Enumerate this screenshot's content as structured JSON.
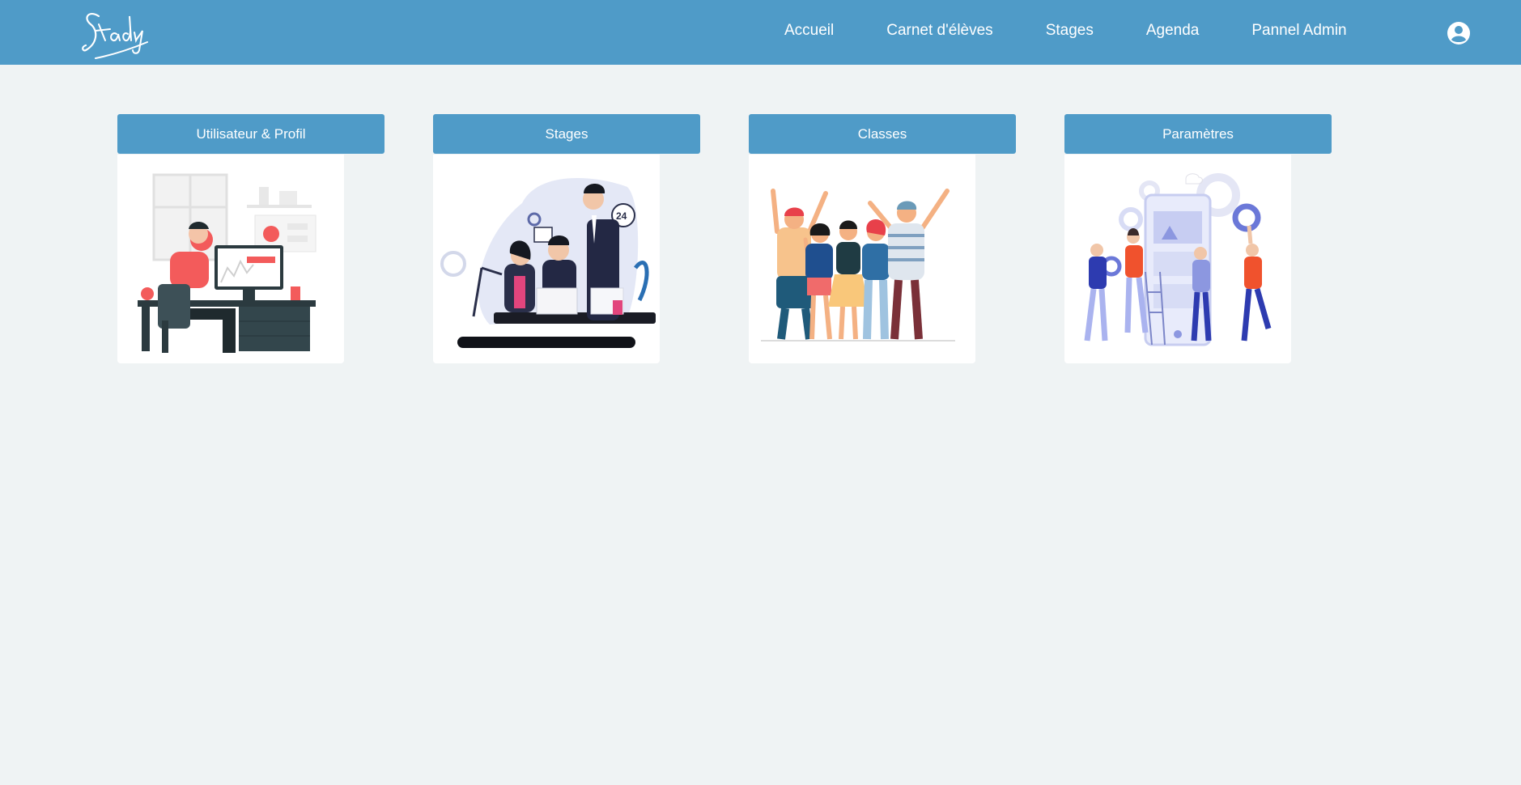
{
  "app": {
    "logo_text": "Stady"
  },
  "nav": {
    "items": [
      {
        "label": "Accueil"
      },
      {
        "label": "Carnet d'élèves"
      },
      {
        "label": "Stages"
      },
      {
        "label": "Agenda"
      },
      {
        "label": "Pannel Admin"
      }
    ],
    "profile_icon": "user-circle-icon"
  },
  "cards": [
    {
      "title": "Utilisateur & Profil",
      "illustration": "person-at-desk-illustration"
    },
    {
      "title": "Stages",
      "illustration": "office-team-illustration"
    },
    {
      "title": "Classes",
      "illustration": "cheering-group-illustration"
    },
    {
      "title": "Paramètres",
      "illustration": "people-with-gears-illustration"
    }
  ],
  "colors": {
    "accent": "#4f9bc8",
    "background": "#eff3f4",
    "card_background": "#ffffff"
  }
}
